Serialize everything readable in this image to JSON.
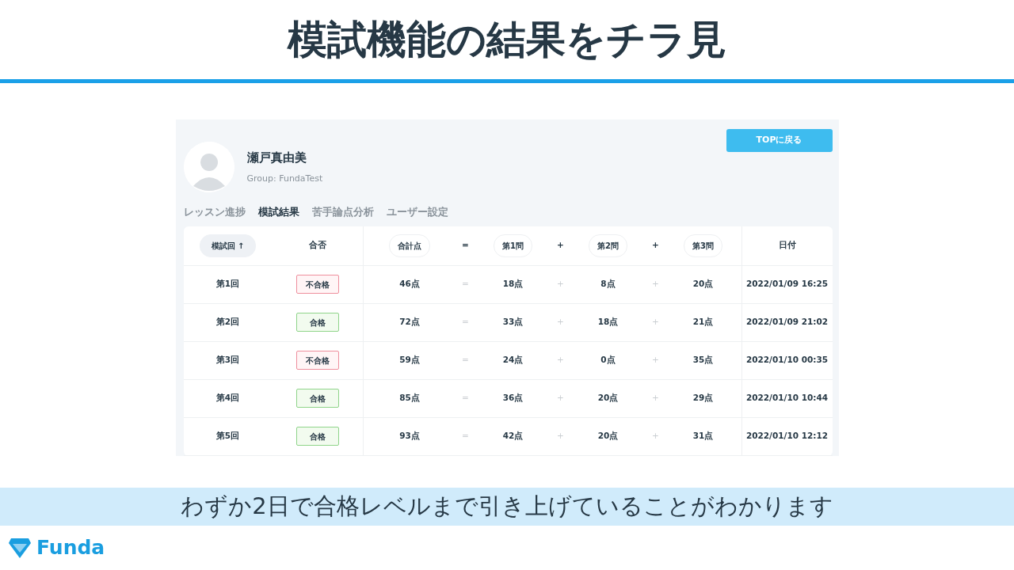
{
  "slide": {
    "title": "模試機能の結果をチラ見",
    "caption": "わずか2日で合格レベルまで引き上げていることがわかります",
    "logo": "Funda"
  },
  "profile": {
    "name": "瀬戸真由美",
    "group": "Group: FundaTest"
  },
  "top_button": "TOPに戻る",
  "tabs": [
    {
      "label": "レッスン進捗",
      "selected": false
    },
    {
      "label": "模試結果",
      "selected": true
    },
    {
      "label": "苦手論点分析",
      "selected": false
    },
    {
      "label": "ユーザー設定",
      "selected": false
    }
  ],
  "table": {
    "columns": [
      {
        "label": "模試回",
        "kind": "chip",
        "sorted": true,
        "sort_arrow": "↑"
      },
      {
        "label": "合否",
        "kind": "plain"
      },
      {
        "label": "合計点",
        "kind": "chip",
        "sorted": false
      },
      {
        "label": "=",
        "kind": "operator"
      },
      {
        "label": "第1問",
        "kind": "chip",
        "sorted": false
      },
      {
        "label": "+",
        "kind": "operator"
      },
      {
        "label": "第2問",
        "kind": "chip",
        "sorted": false
      },
      {
        "label": "+",
        "kind": "operator"
      },
      {
        "label": "第3問",
        "kind": "chip",
        "sorted": false
      },
      {
        "label": "日付",
        "kind": "plain"
      }
    ],
    "rows": [
      {
        "cells": [
          "第1回",
          {
            "label": "不合格",
            "passed": false
          },
          "46点",
          "=",
          "18点",
          "+",
          "8点",
          "+",
          "20点",
          "2022/01/09 16:25"
        ]
      },
      {
        "cells": [
          "第2回",
          {
            "label": "合格",
            "passed": true
          },
          "72点",
          "=",
          "33点",
          "+",
          "18点",
          "+",
          "21点",
          "2022/01/09 21:02"
        ]
      },
      {
        "cells": [
          "第3回",
          {
            "label": "不合格",
            "passed": false
          },
          "59点",
          "=",
          "24点",
          "+",
          "0点",
          "+",
          "35点",
          "2022/01/10 00:35"
        ]
      },
      {
        "cells": [
          "第4回",
          {
            "label": "合格",
            "passed": true
          },
          "85点",
          "=",
          "36点",
          "+",
          "20点",
          "+",
          "29点",
          "2022/01/10 10:44"
        ]
      },
      {
        "cells": [
          "第5回",
          {
            "label": "合格",
            "passed": true
          },
          "93点",
          "=",
          "42点",
          "+",
          "20点",
          "+",
          "31点",
          "2022/01/10 12:12"
        ]
      }
    ]
  }
}
